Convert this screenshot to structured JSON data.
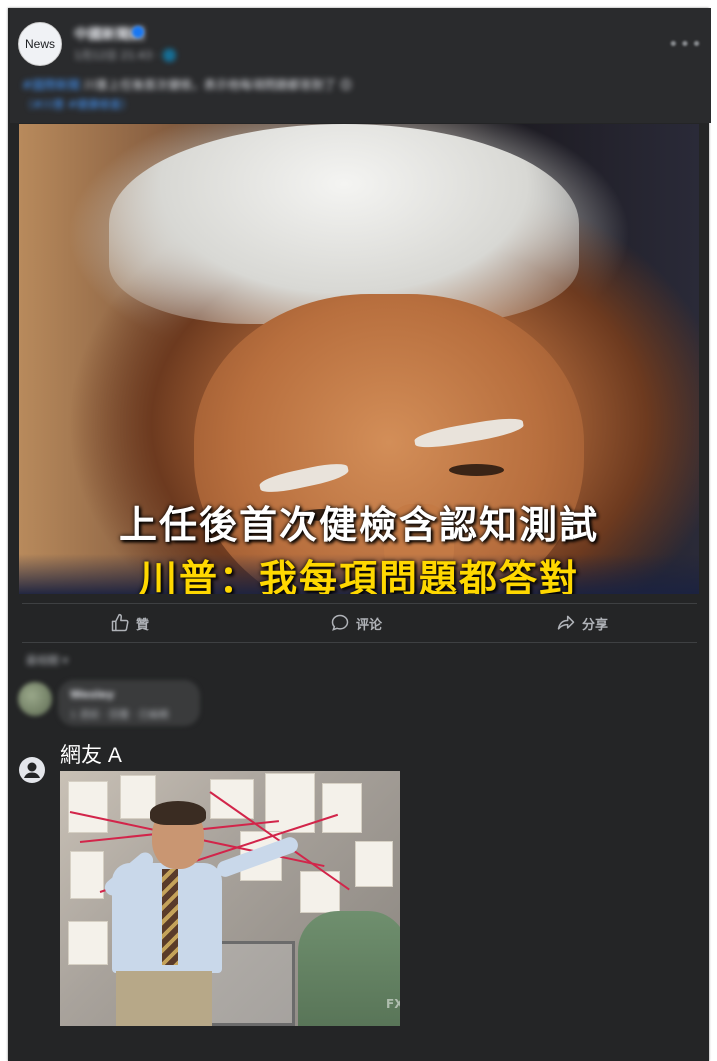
{
  "post": {
    "avatar_text": "News",
    "page_name": "中國新聞網",
    "post_meta": "1月12日 21:43 · 🌐",
    "caption_highlight": "#國際新聞",
    "caption_text": " 川普上任後首次健檢，表示他每項問題都答對了 😊",
    "caption_link": "（#川普 #健康檢查）",
    "more_icon": "more-horizontal-icon"
  },
  "image": {
    "headline": "上任後首次健檢含認知測試",
    "subline": "川普：我每項問題都答對"
  },
  "actions": {
    "like": "贊",
    "comment": "评论",
    "share": "分享"
  },
  "comments": {
    "sort_label": "最相關 ▾",
    "first": {
      "name": "Wesley",
      "text": "1 週前 · 回覆 · 已編輯"
    },
    "reply": {
      "name": "網友 A",
      "meme_watermark": "FX"
    }
  },
  "colors": {
    "card_bg": "#242526",
    "text_primary": "#e4e6eb",
    "text_secondary": "#b0b3b8",
    "accent_blue": "#1877f2",
    "headline_yellow": "#ffd800"
  }
}
